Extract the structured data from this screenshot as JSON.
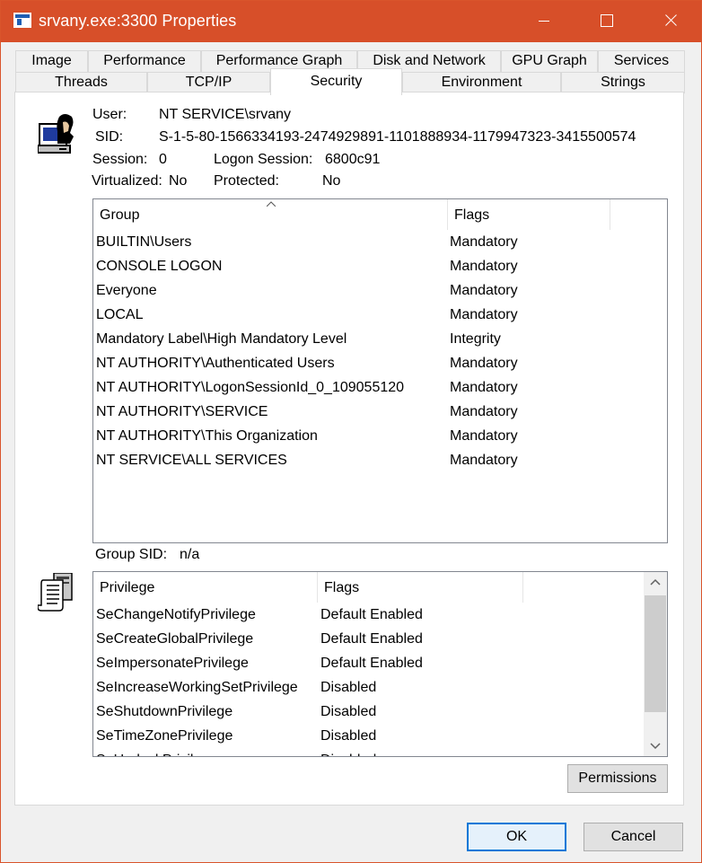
{
  "window": {
    "title": "srvany.exe:3300 Properties"
  },
  "tabs_row1": [
    "Image",
    "Performance",
    "Performance Graph",
    "Disk and Network",
    "GPU Graph",
    "Services"
  ],
  "tabs_row2": [
    "Threads",
    "TCP/IP",
    "Security",
    "Environment",
    "Strings"
  ],
  "active_tab": "Security",
  "token": {
    "user_label": "User:",
    "user_value": "NT SERVICE\\srvany",
    "sid_label": "SID:",
    "sid_value": "S-1-5-80-1566334193-2474929891-1101888934-1179947323-3415500574",
    "session_label": "Session:",
    "session_value": "0",
    "logon_session_label": "Logon Session:",
    "logon_session_value": "6800c91",
    "virtualized_label": "Virtualized:",
    "virtualized_value": "No",
    "protected_label": "Protected:",
    "protected_value": "No"
  },
  "groups": {
    "columns": [
      "Group",
      "Flags"
    ],
    "rows": [
      {
        "group": "BUILTIN\\Users",
        "flags": "Mandatory"
      },
      {
        "group": "CONSOLE LOGON",
        "flags": "Mandatory"
      },
      {
        "group": "Everyone",
        "flags": "Mandatory"
      },
      {
        "group": "LOCAL",
        "flags": "Mandatory"
      },
      {
        "group": "Mandatory Label\\High Mandatory Level",
        "flags": "Integrity"
      },
      {
        "group": "NT AUTHORITY\\Authenticated Users",
        "flags": "Mandatory"
      },
      {
        "group": "NT AUTHORITY\\LogonSessionId_0_109055120",
        "flags": "Mandatory"
      },
      {
        "group": "NT AUTHORITY\\SERVICE",
        "flags": "Mandatory"
      },
      {
        "group": "NT AUTHORITY\\This Organization",
        "flags": "Mandatory"
      },
      {
        "group": "NT SERVICE\\ALL SERVICES",
        "flags": "Mandatory"
      }
    ]
  },
  "group_sid": {
    "label": "Group SID:",
    "value": "n/a"
  },
  "privileges": {
    "columns": [
      "Privilege",
      "Flags"
    ],
    "rows": [
      {
        "privilege": "SeChangeNotifyPrivilege",
        "flags": "Default Enabled"
      },
      {
        "privilege": "SeCreateGlobalPrivilege",
        "flags": "Default Enabled"
      },
      {
        "privilege": "SeImpersonatePrivilege",
        "flags": "Default Enabled"
      },
      {
        "privilege": "SeIncreaseWorkingSetPrivilege",
        "flags": "Disabled"
      },
      {
        "privilege": "SeShutdownPrivilege",
        "flags": "Disabled"
      },
      {
        "privilege": "SeTimeZonePrivilege",
        "flags": "Disabled"
      },
      {
        "privilege": "SeUndockPrivilege",
        "flags": "Disabled"
      }
    ]
  },
  "buttons": {
    "permissions": "Permissions",
    "ok": "OK",
    "cancel": "Cancel"
  },
  "icons": {
    "app": "process-window-icon",
    "user": "user-at-computer-icon",
    "privileges": "scroll-document-icon"
  },
  "colors": {
    "titlebar": "#d74f29",
    "accent": "#0078d7"
  }
}
